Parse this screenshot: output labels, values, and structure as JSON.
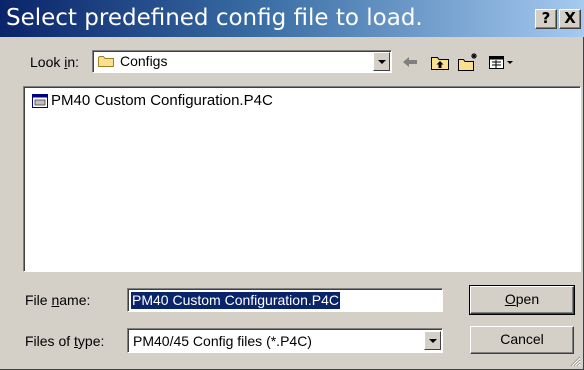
{
  "dialog": {
    "title": "Select predefined config file to load.",
    "help_label": "?",
    "close_label": "X"
  },
  "toolbar": {
    "look_in_label": "Look in:",
    "look_in_value": "Configs",
    "look_in_icon": "folder-icon",
    "back_icon": "back-arrow-icon",
    "up_icon": "up-folder-icon",
    "new_folder_icon": "new-folder-icon",
    "views_icon": "view-menu-icon"
  },
  "file_list": {
    "items": [
      {
        "name": "PM40 Custom Configuration.P4C",
        "icon": "config-file-icon"
      }
    ]
  },
  "form": {
    "file_name_label": "File name:",
    "file_name_value": "PM40 Custom Configuration.P4C",
    "file_type_label": "Files of type:",
    "file_type_value": "PM40/45 Config files (*.P4C)"
  },
  "buttons": {
    "open_label": "Open",
    "cancel_label": "Cancel"
  },
  "colors": {
    "title_start": "#0a246a",
    "title_end": "#a6caf0",
    "face": "#d4d0c8",
    "selection": "#0a246a"
  }
}
